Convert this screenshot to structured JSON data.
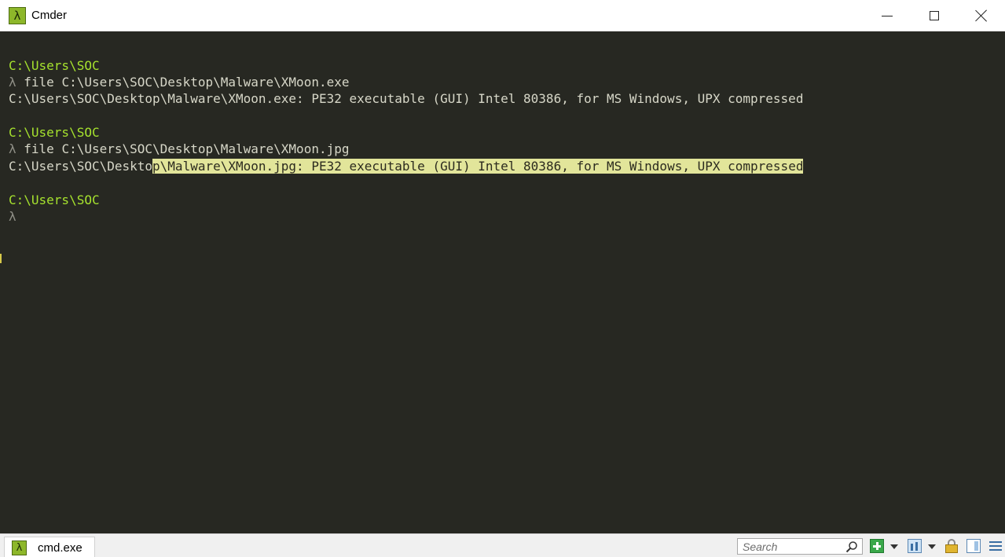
{
  "window": {
    "title": "Cmder",
    "app_icon_glyph": "λ",
    "minimize_icon": "minimize-icon",
    "maximize_icon": "maximize-icon",
    "close_icon": "close-icon"
  },
  "terminal": {
    "colors": {
      "background": "#272822",
      "prompt_path": "#a6e22e",
      "text": "#d7d7c8",
      "highlight_bg": "#e2e59a"
    },
    "lines": [
      {
        "path": "C:\\Users\\SOC"
      },
      {
        "lambda": "λ",
        "command": " file C:\\Users\\SOC\\Desktop\\Malware\\XMoon.exe"
      },
      {
        "output": "C:\\Users\\SOC\\Desktop\\Malware\\XMoon.exe: PE32 executable (GUI) Intel 80386, for MS Windows, UPX compressed"
      },
      {
        "path": "C:\\Users\\SOC"
      },
      {
        "lambda": "λ",
        "command": " file C:\\Users\\SOC\\Desktop\\Malware\\XMoon.jpg"
      },
      {
        "output_plain": "C:\\Users\\SOC\\Deskto",
        "output_selected": "p\\Malware\\XMoon.jpg: PE32 executable (GUI) Intel 80386, for MS Windows, UPX compressed"
      },
      {
        "path": "C:\\Users\\SOC"
      },
      {
        "lambda": "λ"
      }
    ]
  },
  "statusbar": {
    "tab": {
      "icon_glyph": "λ",
      "label": "cmd.exe"
    },
    "search": {
      "placeholder": "Search"
    },
    "icons": [
      "search-icon",
      "new-console-plus-icon",
      "chevron-down-icon",
      "split-view-icon",
      "chevron-down-icon",
      "lock-icon",
      "panel-icon",
      "menu-icon"
    ]
  }
}
